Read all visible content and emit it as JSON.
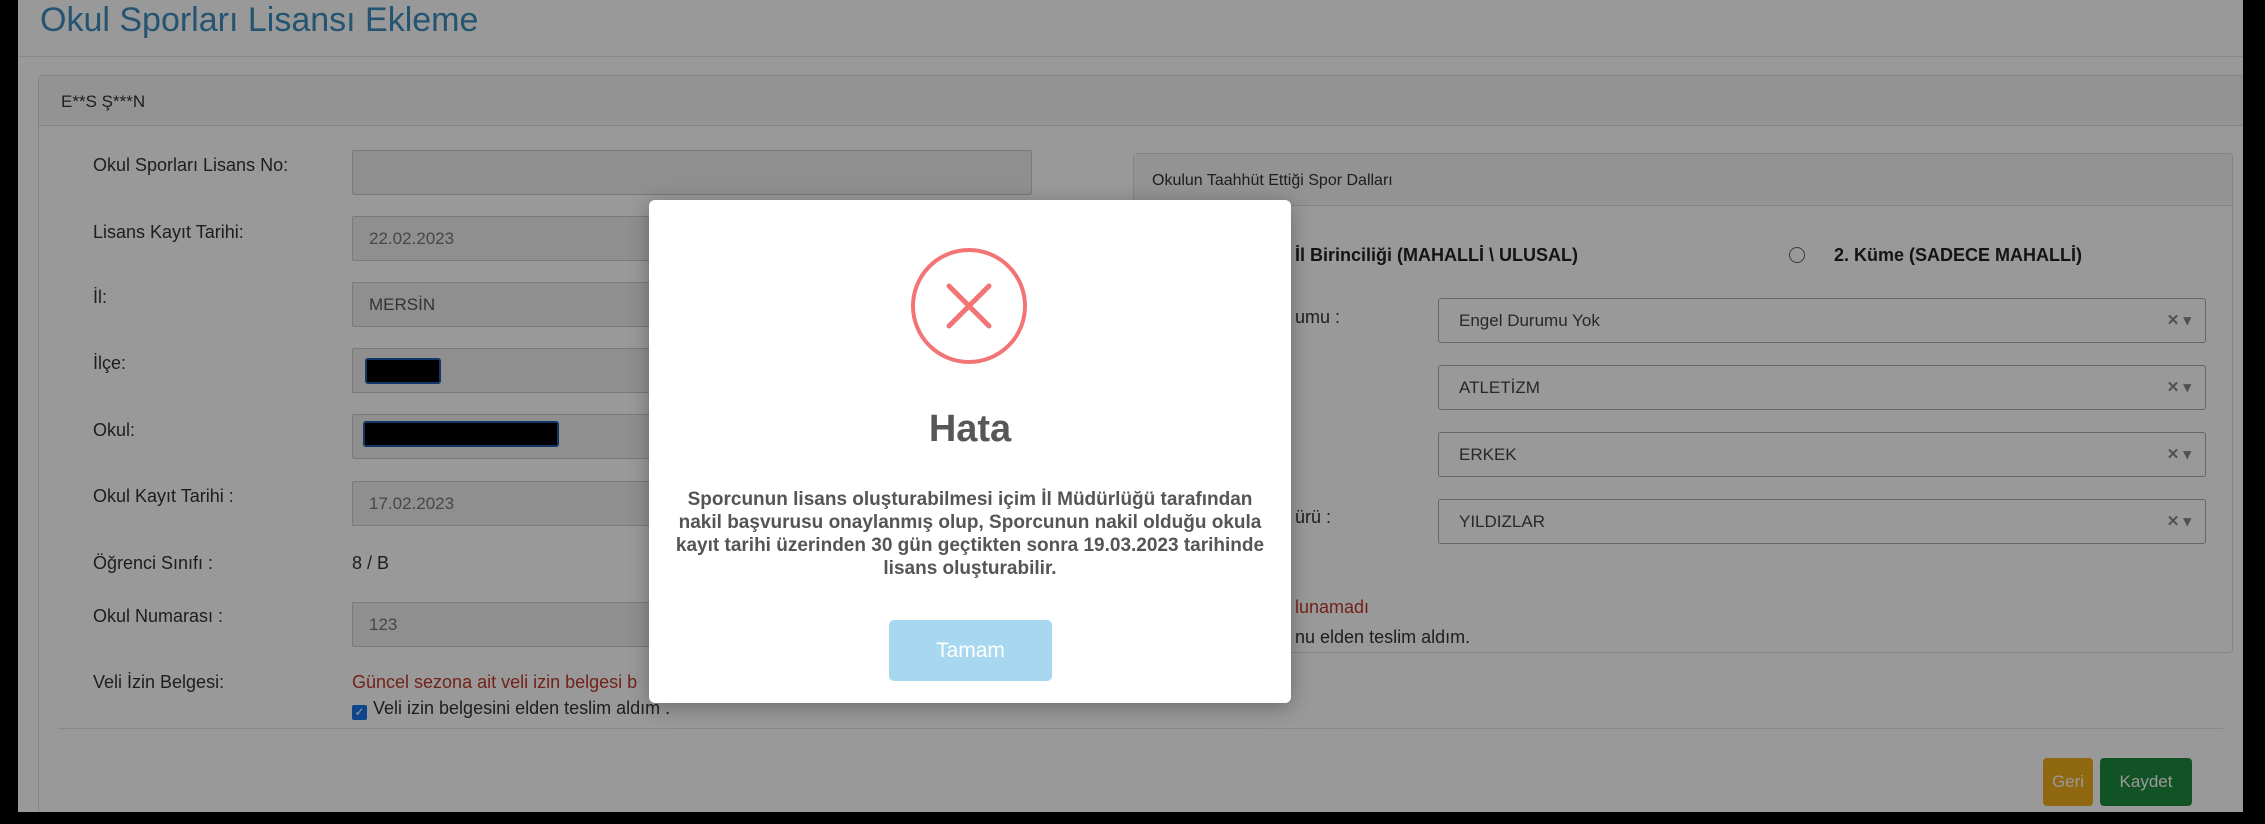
{
  "page": {
    "title": "Okul Sporları Lisansı Ekleme"
  },
  "panel": {
    "student_name": "E**S Ş***N"
  },
  "form": {
    "license_no_label": "Okul Sporları Lisans No:",
    "license_no_value": "",
    "registration_date_label": "Lisans Kayıt Tarihi:",
    "registration_date_value": "22.02.2023",
    "province_label": "İl:",
    "province_value": "MERSİN",
    "district_label": "İlçe:",
    "school_label": "Okul:",
    "school_registration_label": "Okul Kayıt Tarihi :",
    "school_registration_value": "17.02.2023",
    "grade_label": "Öğrenci Sınıfı :",
    "grade_value": "8 / B",
    "school_number_label": "Okul Numarası :",
    "school_number_value": "123",
    "parent_permission_label": "Veli İzin Belgesi:",
    "parent_permission_warning": "Güncel sezona ait veli izin belgesi b",
    "parent_permission_checkbox": "Veli izin belgesini elden teslim aldım ."
  },
  "sports": {
    "heading": "Okulun Taahhüt Ettiği Spor Dalları",
    "radio1_label": "İl Birinciliği (MAHALLİ \\ ULUSAL)",
    "radio2_label": "2. Küme (SADECE MAHALLİ)",
    "disability_label_partial": "umu :",
    "disability_value": "Engel Durumu Yok",
    "sport_value": "ATLETİZM",
    "gender_value": "ERKEK",
    "category_label_partial": "ürü :",
    "category_value": "YILDIZLAR",
    "not_found_partial": "lunamadı",
    "delivered_partial": "nu elden teslim aldım."
  },
  "buttons": {
    "back": "Geri",
    "save": "Kaydet"
  },
  "modal": {
    "title": "Hata",
    "message": "Sporcunun lisans oluşturabilmesi içim İl Müdürlüğü tarafından nakil başvurusu onaylanmış olup, Sporcunun nakil olduğu okula kayıt tarihi üzerinden 30 gün geçtikten sonra 19.03.2023 tarihinde lisans oluşturabilir.",
    "ok_button": "Tamam",
    "icon": "error-x-icon"
  },
  "colors": {
    "title_blue": "#3c8dbc",
    "error_red": "#f27474",
    "warning_red": "#c0392b",
    "back_button": "#f0ad1c",
    "save_button": "#1e8a3e",
    "modal_button": "#a8d8f0"
  }
}
